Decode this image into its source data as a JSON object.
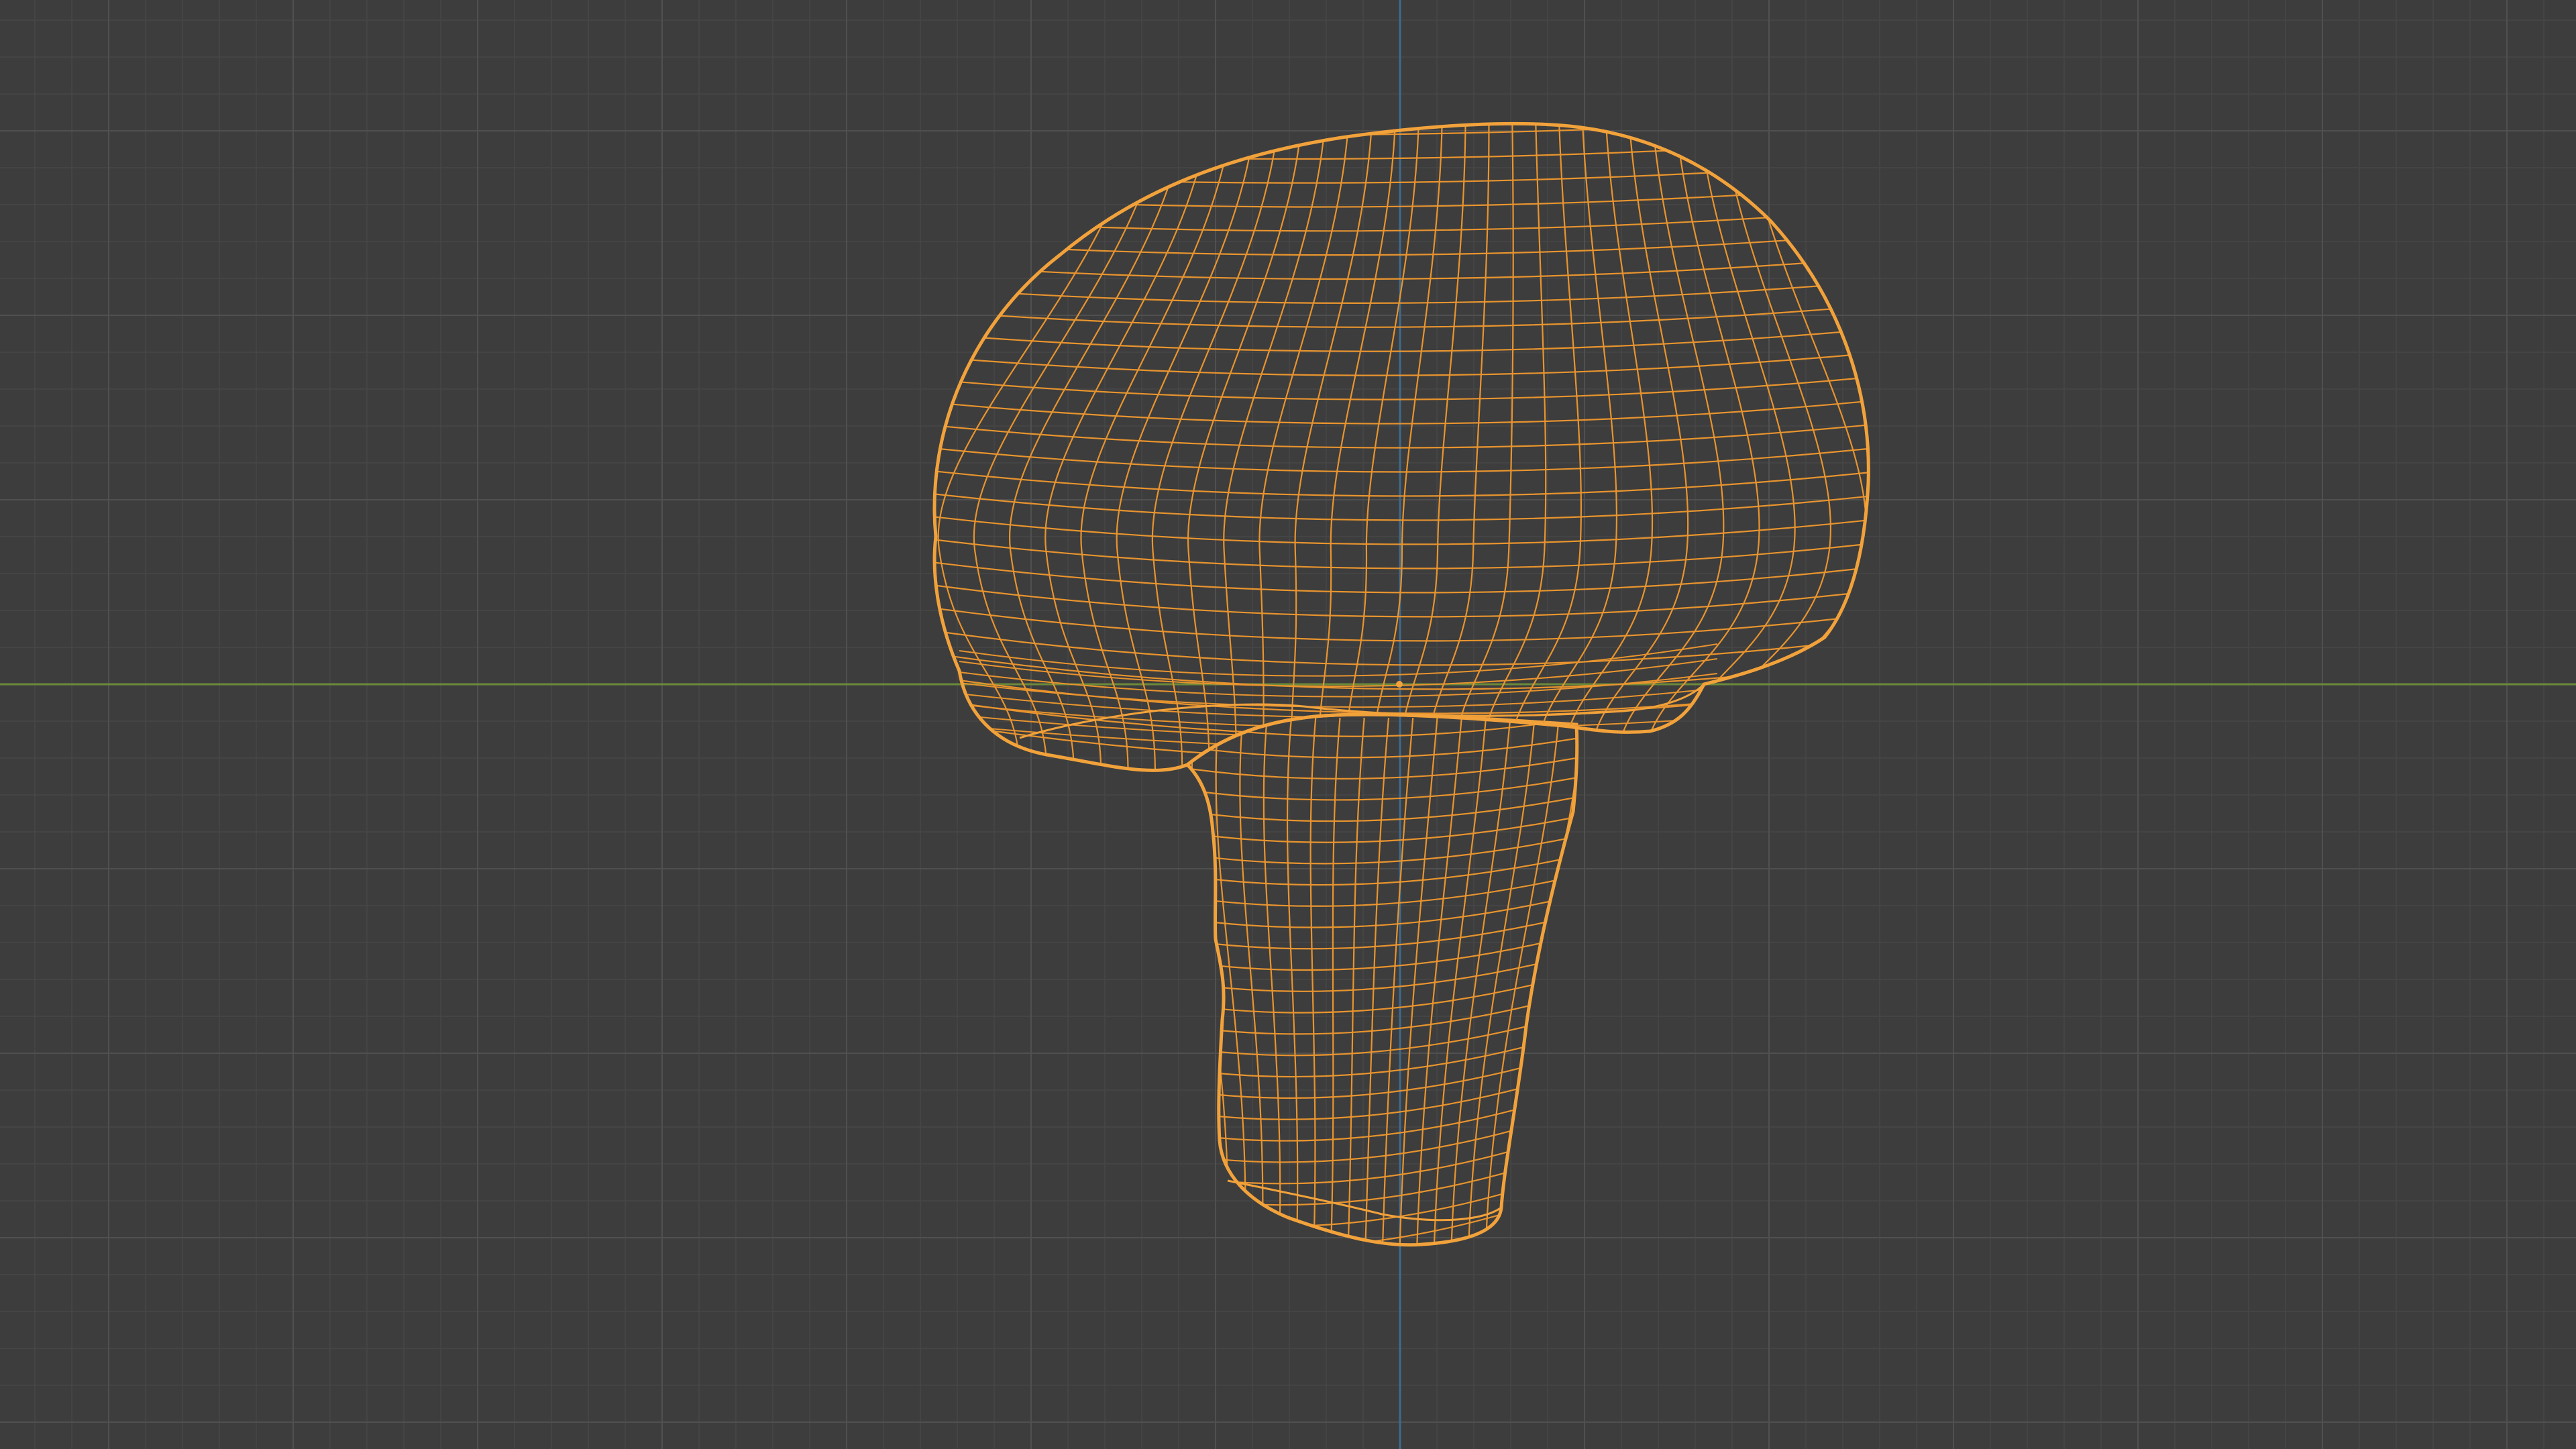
{
  "viewport": {
    "background": "#3d3d3d",
    "grid_minor_color": "#474747",
    "grid_major_color": "#505050",
    "x_axis_color": "#6c8a3a",
    "y_axis_color": "#3f6a8e",
    "display_mode": "wireframe"
  },
  "object": {
    "type": "mushroom-mesh",
    "selected": true,
    "wire_color": "#e8942e",
    "outline_color": "#f2a23b",
    "origin_color": "#f2a23b"
  }
}
